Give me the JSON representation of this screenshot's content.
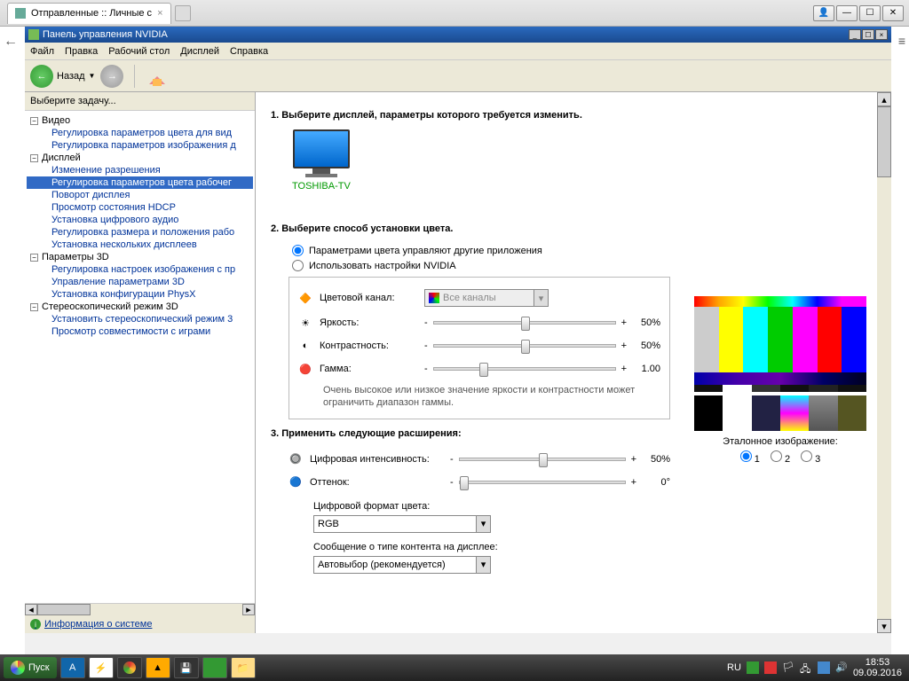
{
  "browser": {
    "tab_title": "Отправленные :: Личные с"
  },
  "app": {
    "title": "Панель управления NVIDIA",
    "menu": [
      "Файл",
      "Правка",
      "Рабочий стол",
      "Дисплей",
      "Справка"
    ],
    "back_label": "Назад"
  },
  "sidebar": {
    "header": "Выберите задачу...",
    "groups": [
      {
        "label": "Видео",
        "items": [
          "Регулировка параметров цвета для вид",
          "Регулировка параметров изображения д"
        ]
      },
      {
        "label": "Дисплей",
        "items": [
          "Изменение разрешения",
          "Регулировка параметров цвета рабочег",
          "Поворот дисплея",
          "Просмотр состояния HDCP",
          "Установка цифрового аудио",
          "Регулировка размера и положения рабо",
          "Установка нескольких дисплеев"
        ],
        "selected": 1
      },
      {
        "label": "Параметры 3D",
        "items": [
          "Регулировка настроек изображения с пр",
          "Управление параметрами 3D",
          "Установка конфигурации PhysX"
        ]
      },
      {
        "label": "Стереоскопический режим 3D",
        "items": [
          "Установить стереоскопический режим 3",
          "Просмотр совместимости с играми"
        ]
      }
    ],
    "sysinfo": "Информация о системе"
  },
  "content": {
    "step1": "1. Выберите дисплей, параметры которого требуется изменить.",
    "monitor_name": "TOSHIBA-TV",
    "step2": "2. Выберите способ установки цвета.",
    "radio_other": "Параметрами цвета управляют другие приложения",
    "radio_nvidia": "Использовать настройки NVIDIA",
    "channel_label": "Цветовой канал:",
    "channel_value": "Все каналы",
    "brightness_label": "Яркость:",
    "contrast_label": "Контрастность:",
    "gamma_label": "Гамма:",
    "brightness_value": "50%",
    "contrast_value": "50%",
    "gamma_value": "1.00",
    "note": "Очень высокое или низкое значение яркости и контрастности может ограничить диапазон гаммы.",
    "step3": "3. Применить следующие расширения:",
    "digital_vib_label": "Цифровая интенсивность:",
    "digital_vib_value": "50%",
    "hue_label": "Оттенок:",
    "hue_value": "0°",
    "color_format_label": "Цифровой формат цвета:",
    "color_format_value": "RGB",
    "content_type_label": "Сообщение о типе контента на дисплее:",
    "content_type_value": "Автовыбор (рекомендуется)",
    "ref_label": "Эталонное изображение:",
    "ref_options": [
      "1",
      "2",
      "3"
    ]
  },
  "taskbar": {
    "start": "Пуск",
    "lang": "RU",
    "time": "18:53",
    "date": "09.09.2016"
  }
}
